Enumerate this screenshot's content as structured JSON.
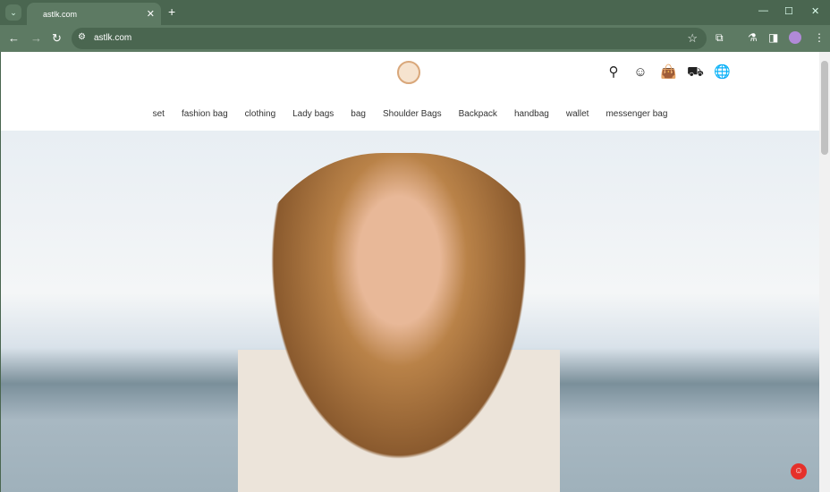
{
  "browser": {
    "tab_title": "astlk.com",
    "url": "astlk.com"
  },
  "menu": [
    "set",
    "fashion bag",
    "clothing",
    "Lady bags",
    "bag",
    "Shoulder Bags",
    "Backpack",
    "handbag",
    "wallet",
    "messenger bag"
  ],
  "icons": [
    "search-icon",
    "account-icon",
    "cart-icon",
    "delivery-icon",
    "globe-icon"
  ]
}
